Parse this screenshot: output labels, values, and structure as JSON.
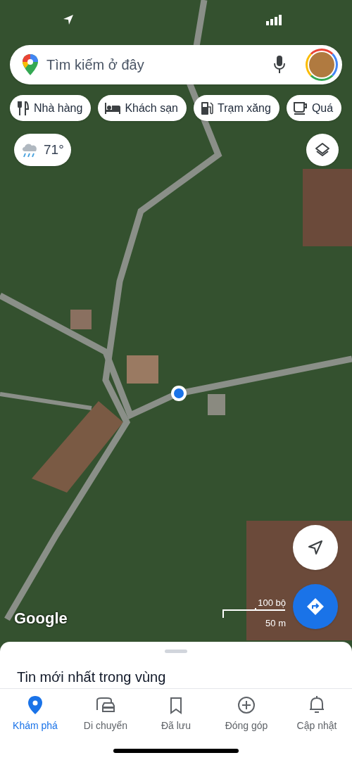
{
  "search": {
    "placeholder": "Tìm kiếm ở đây"
  },
  "chips": [
    {
      "kind": "restaurant",
      "label": "Nhà hàng"
    },
    {
      "kind": "hotel",
      "label": "Khách sạn"
    },
    {
      "kind": "gas",
      "label": "Trạm xăng"
    },
    {
      "kind": "cafe",
      "label": "Quá"
    }
  ],
  "weather": {
    "temperature": "71°"
  },
  "map": {
    "logo": "Google",
    "scale_imperial": "100 bộ",
    "scale_metric": "50 m"
  },
  "sheet": {
    "heading": "Tin mới nhất trong vùng"
  },
  "nav": [
    {
      "kind": "explore",
      "label": "Khám phá",
      "selected": true
    },
    {
      "kind": "commute",
      "label": "Di chuyển",
      "selected": false
    },
    {
      "kind": "saved",
      "label": "Đã lưu",
      "selected": false
    },
    {
      "kind": "contribute",
      "label": "Đóng góp",
      "selected": false
    },
    {
      "kind": "updates",
      "label": "Cập nhật",
      "selected": false
    }
  ]
}
